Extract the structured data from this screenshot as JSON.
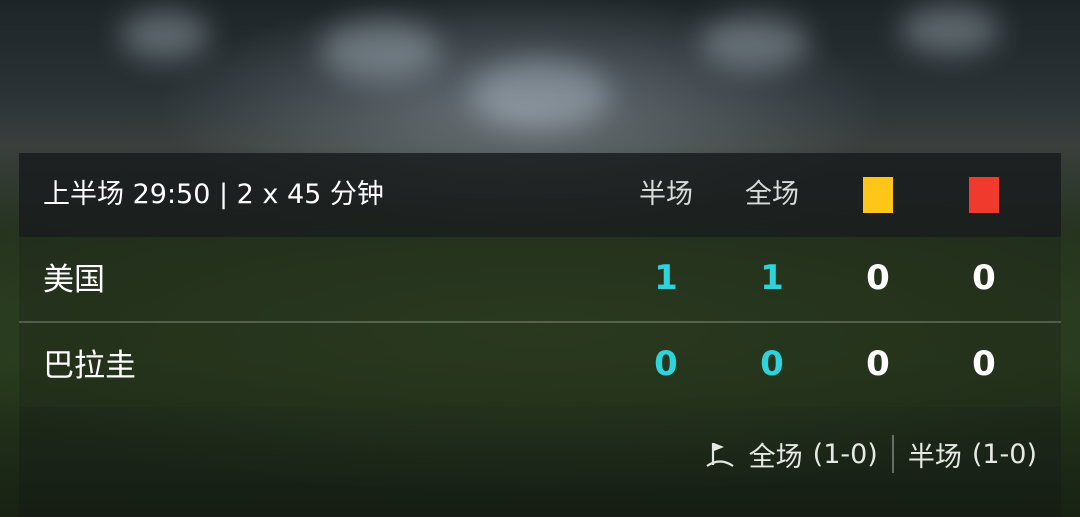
{
  "match": {
    "status": "上半场 29:50 | 2 x 45 分钟"
  },
  "columns": {
    "half": "半场",
    "full": "全场",
    "yellow_card": "yellow-card",
    "red_card": "red-card"
  },
  "teams": [
    {
      "name": "美国",
      "half": "1",
      "full": "1",
      "yellow": "0",
      "red": "0"
    },
    {
      "name": "巴拉圭",
      "half": "0",
      "full": "0",
      "yellow": "0",
      "red": "0"
    }
  ],
  "footer": {
    "icon": "corner-flag-icon",
    "full_label": "全场",
    "full_score": "(1-0)",
    "half_label": "半场",
    "half_score": "(1-0)"
  },
  "colors": {
    "score_accent": "#2ed3dc",
    "yellow_card": "#ffc61a",
    "red_card": "#f03a2e"
  }
}
